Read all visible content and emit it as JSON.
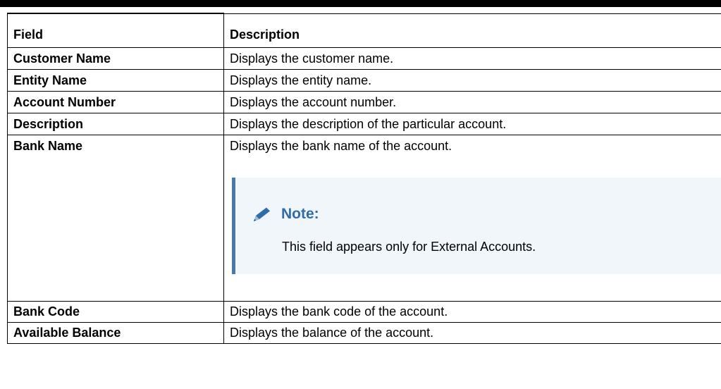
{
  "table": {
    "headers": {
      "field": "Field",
      "description": "Description"
    },
    "rows": [
      {
        "field": "Customer Name",
        "description": "Displays the customer name."
      },
      {
        "field": "Entity Name",
        "description": "Displays the entity name."
      },
      {
        "field": "Account Number",
        "description": "Displays the account number."
      },
      {
        "field": "Description",
        "description": "Displays the description of the particular account."
      },
      {
        "field": "Bank Name",
        "description": "Displays the bank name of the account."
      },
      {
        "field": "Bank Code",
        "description": "Displays the bank code of the account."
      },
      {
        "field": "Available Balance",
        "description": "Displays the balance of the account."
      }
    ]
  },
  "note": {
    "icon": "pencil-icon",
    "title": "Note:",
    "text": "This field appears only for External Accounts.",
    "accent_color": "#4a78ad",
    "title_color": "#2f6cab",
    "background_color": "#f1f6fb"
  }
}
